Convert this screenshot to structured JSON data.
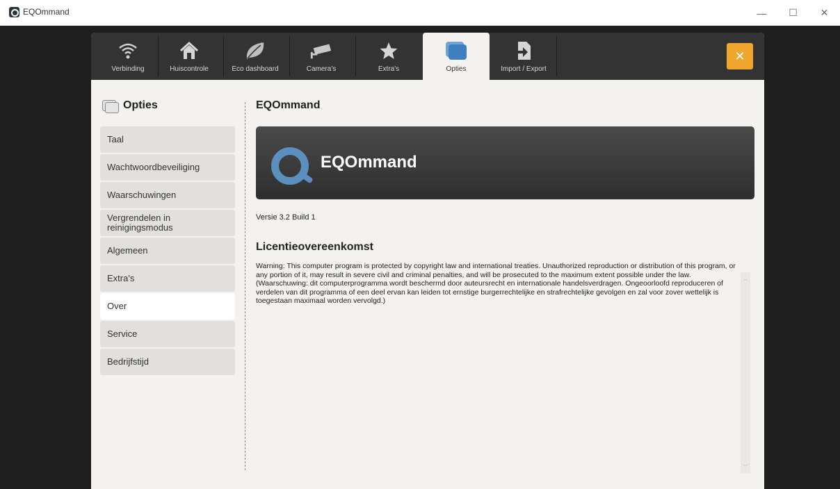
{
  "window": {
    "title": "EQOmmand",
    "controls": {
      "minimize": "—",
      "maximize": "☐",
      "close": "✕"
    }
  },
  "tabs": [
    {
      "label": "Verbinding",
      "icon": "wifi-icon"
    },
    {
      "label": "Huiscontrole",
      "icon": "house-icon"
    },
    {
      "label": "Eco dashboard",
      "icon": "leaf-icon"
    },
    {
      "label": "Camera's",
      "icon": "camera-icon"
    },
    {
      "label": "Extra's",
      "icon": "star-icon"
    },
    {
      "label": "Opties",
      "icon": "options-icon",
      "active": true
    },
    {
      "label": "Import / Export",
      "icon": "import-export-icon"
    }
  ],
  "close_button": "✕",
  "sidebar": {
    "title": "Opties",
    "items": [
      {
        "label": "Taal"
      },
      {
        "label": "Wachtwoordbeveiliging"
      },
      {
        "label": "Waarschuwingen"
      },
      {
        "label": "Vergrendelen in reinigingsmodus"
      },
      {
        "label": "Algemeen"
      },
      {
        "label": "Extra's"
      },
      {
        "label": "Over",
        "active": true
      },
      {
        "label": "Service"
      },
      {
        "label": "Bedrijfstijd"
      }
    ]
  },
  "main": {
    "title": "EQOmmand",
    "banner_text": "EQOmmand",
    "version": "Versie 3.2 Build 1",
    "license_title": "Licentieovereenkomst",
    "license_text": "Warning: This computer program is protected by copyright law and international treaties. Unauthorized reproduction or distribution of this program, or any portion of it, may result in severe civil and criminal penalties, and will be prosecuted to the maximum extent possible under the law. (Waarschuwing: dit computerprogramma wordt beschermd door auteursrecht en internationale handelsverdragen. Ongeoorloofd reproduceren of verdelen van dit programma of een deel ervan kan leiden tot ernstige burgerrechtelijke en strafrechtelijke gevolgen en zal voor zover wettelijk is toegestaan maximaal worden vervolgd.)"
  },
  "colors": {
    "topbar": "#333333",
    "accent": "#f0a52c",
    "brand_blue": "#5b8fc0",
    "panel": "#f4f2ef"
  }
}
